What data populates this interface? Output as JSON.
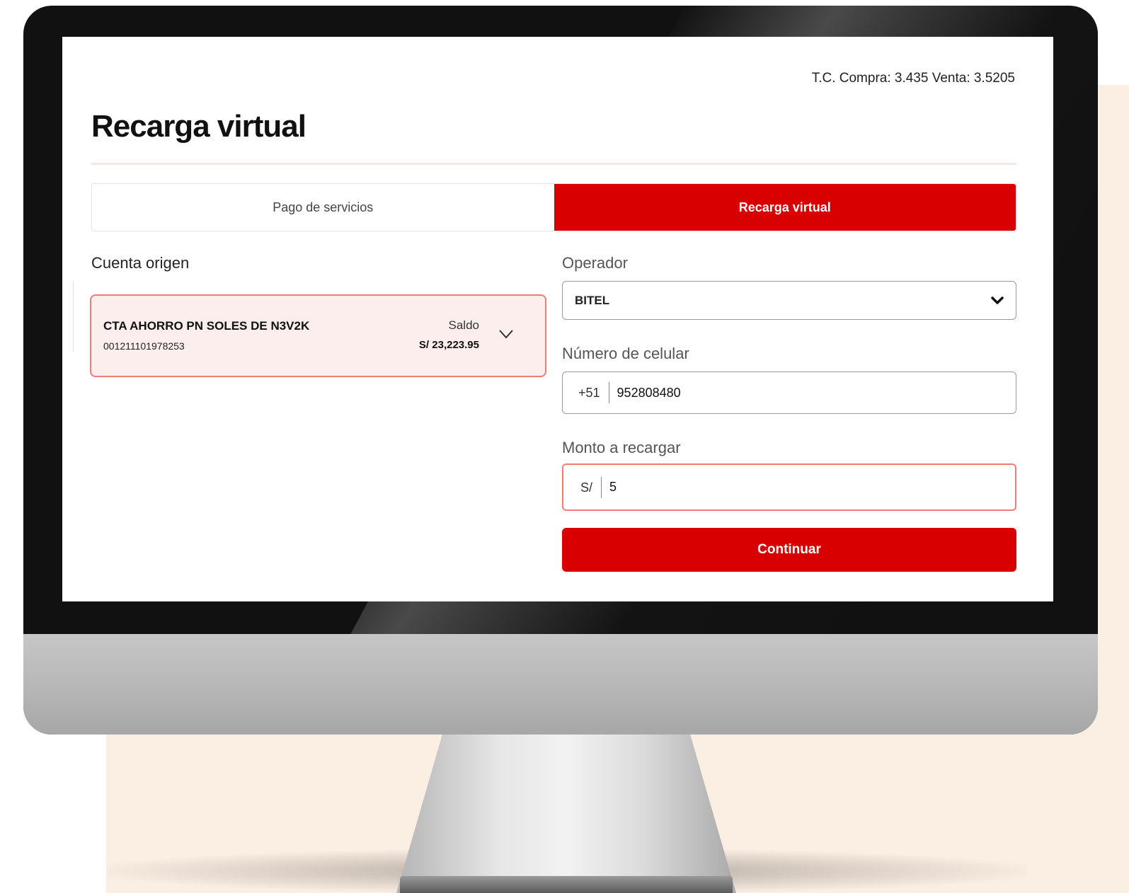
{
  "exchange_rate": "T.C. Compra: 3.435 Venta: 3.5205",
  "page_title": "Recarga virtual",
  "tabs": [
    {
      "label": "Pago de servicios",
      "active": false
    },
    {
      "label": "Recarga virtual",
      "active": true
    }
  ],
  "source_account": {
    "section_label": "Cuenta origen",
    "name": "CTA AHORRO PN SOLES DE N3V2K",
    "number": "001211101978253",
    "balance_label": "Saldo",
    "balance": "S/ 23,223.95"
  },
  "operator": {
    "label": "Operador",
    "selected": "BITEL"
  },
  "phone": {
    "label": "Número de celular",
    "prefix": "+51",
    "value": "952808480"
  },
  "amount": {
    "label": "Monto a recargar",
    "prefix": "S/",
    "value": "5"
  },
  "continue_label": "Continuar",
  "colors": {
    "brand_red": "#d80000",
    "error_border": "#ef7b7b",
    "card_bg": "#fdeeee",
    "background_blob": "#fbefe4"
  }
}
